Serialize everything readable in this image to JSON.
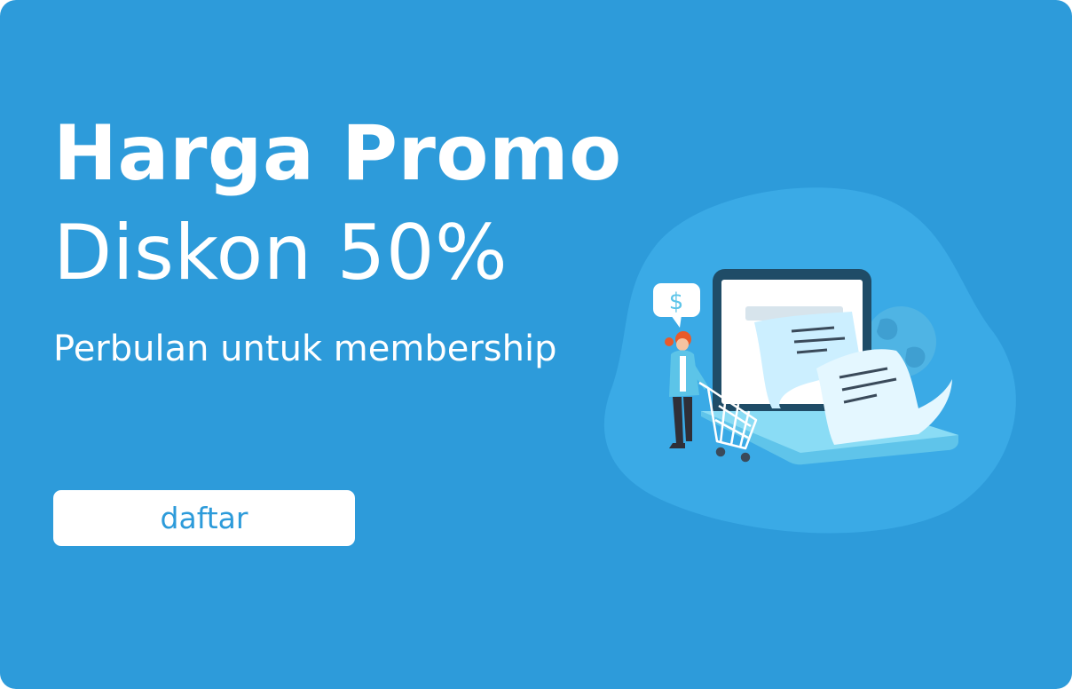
{
  "banner": {
    "headline": "Harga Promo",
    "subheadline": "Diskon 50%",
    "caption": "Perbulan untuk membership",
    "cta_label": "daftar"
  },
  "illustration": {
    "icons": [
      "dollar-icon",
      "laptop-icon",
      "receipt-icon",
      "globe-icon",
      "shopping-cart-icon",
      "shopper-figure"
    ]
  },
  "colors": {
    "background": "#2d9bda",
    "blob": "#3aaae6",
    "text": "#ffffff",
    "button_bg": "#ffffff",
    "button_text": "#2d9bda",
    "laptop_dark": "#1f4c67",
    "laptop_screen": "#ffffff",
    "accent_light": "#82d8f5",
    "shirt": "#5cc4e8",
    "hair": "#e95a2a"
  }
}
